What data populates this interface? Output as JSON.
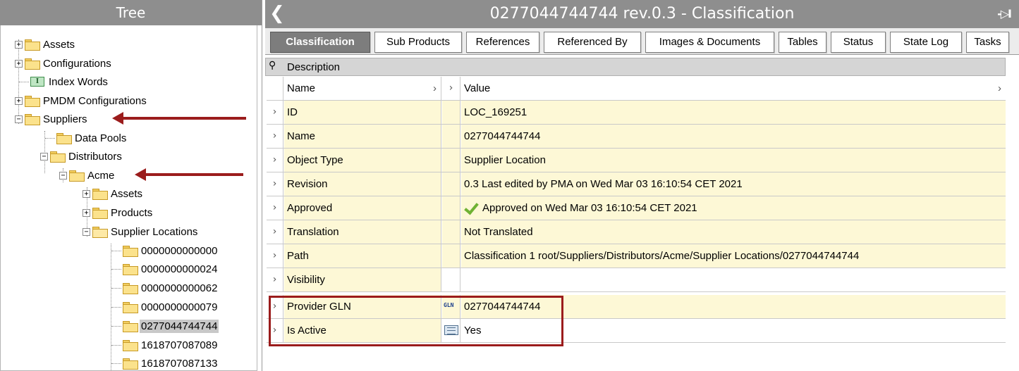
{
  "tree": {
    "header": "Tree",
    "items": [
      {
        "label": "Assets"
      },
      {
        "label": "Configurations"
      },
      {
        "label": "Index Words"
      },
      {
        "label": "PMDM Configurations"
      },
      {
        "label": "Suppliers"
      },
      {
        "label": "Data Pools"
      },
      {
        "label": "Distributors"
      },
      {
        "label": "Acme"
      },
      {
        "label": "Assets"
      },
      {
        "label": "Products"
      },
      {
        "label": "Supplier Locations"
      },
      {
        "label": "0000000000000"
      },
      {
        "label": "0000000000024"
      },
      {
        "label": "0000000000062"
      },
      {
        "label": "0000000000079"
      },
      {
        "label": "0277044744744"
      },
      {
        "label": "1618707087089"
      },
      {
        "label": "1618707087133"
      }
    ],
    "selected_item": "0277044744744"
  },
  "window": {
    "title": "0277044744744 rev.0.3 - Classification"
  },
  "tabs": [
    {
      "label": "Classification",
      "active": true
    },
    {
      "label": "Sub Products"
    },
    {
      "label": "References"
    },
    {
      "label": "Referenced By"
    },
    {
      "label": "Images & Documents"
    },
    {
      "label": "Tables"
    },
    {
      "label": "Status"
    },
    {
      "label": "State Log"
    },
    {
      "label": "Tasks"
    }
  ],
  "grid": {
    "section_label": "Description",
    "columns": {
      "name": "Name",
      "value": "Value"
    },
    "rows": [
      {
        "name": "ID",
        "value": "LOC_169251"
      },
      {
        "name": "Name",
        "value": "0277044744744"
      },
      {
        "name": "Object Type",
        "value": "Supplier Location"
      },
      {
        "name": "Revision",
        "value": "0.3 Last edited by PMA on Wed Mar 03 16:10:54 CET 2021"
      },
      {
        "name": "Approved",
        "value": "Approved on Wed Mar 03 16:10:54 CET 2021",
        "icon": "check-icon"
      },
      {
        "name": "Translation",
        "value": "Not Translated"
      },
      {
        "name": "Path",
        "value": "Classification 1 root/Suppliers/Distributors/Acme/Supplier Locations/0277044744744"
      },
      {
        "name": "Visibility",
        "value": ""
      },
      {
        "name": "Provider GLN",
        "value": "0277044744744",
        "type_icon": "GLN"
      },
      {
        "name": "Is Active",
        "value": "Yes",
        "type_icon": "list-icon"
      }
    ]
  },
  "colors": {
    "header_gray": "#8e8e8e",
    "row_yellow": "#fdf8d6",
    "annotation_red": "#9b1c1c",
    "approved_green": "#6fb233"
  }
}
